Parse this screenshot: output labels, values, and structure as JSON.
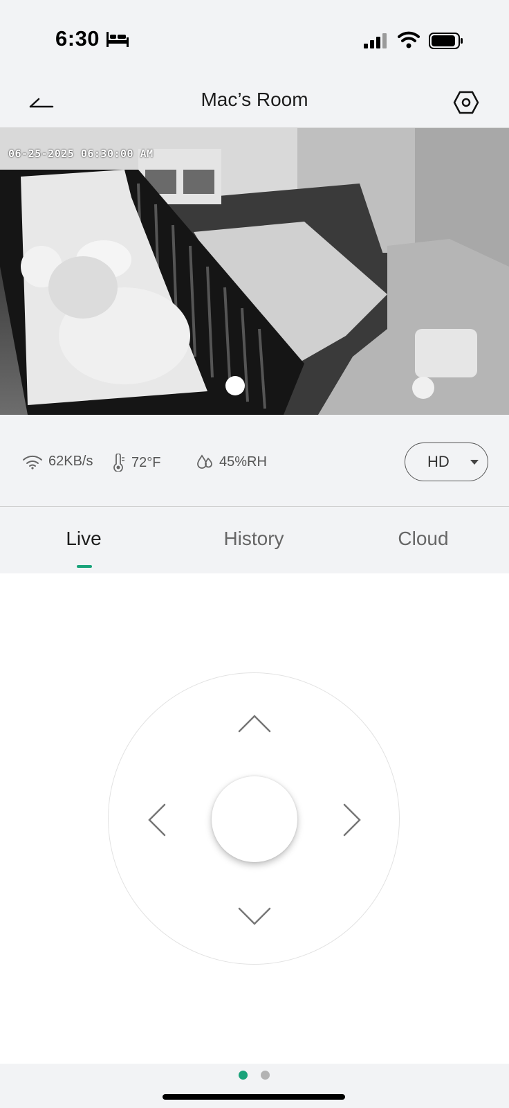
{
  "status_bar": {
    "time": "6:30",
    "icons": [
      "bed-icon",
      "cellular-signal-icon",
      "wifi-icon",
      "battery-icon"
    ]
  },
  "header": {
    "title": "Mac’s Room",
    "back_icon": "back-arrow-icon",
    "settings_icon": "hexagon-settings-icon"
  },
  "camera": {
    "timestamp": "06-25-2025 06:30:00 AM",
    "mode": "night-vision grayscale"
  },
  "stats": {
    "bitrate": "62KB/s",
    "temperature": "72°F",
    "humidity": "45%RH"
  },
  "quality": {
    "selected": "HD"
  },
  "tabs": [
    {
      "label": "Live",
      "active": true
    },
    {
      "label": "History",
      "active": false
    },
    {
      "label": "Cloud",
      "active": false
    }
  ],
  "ptz": {
    "icons": [
      "chevron-up-icon",
      "chevron-down-icon",
      "chevron-left-icon",
      "chevron-right-icon"
    ]
  },
  "pager": {
    "total": 2,
    "current": 1
  },
  "colors": {
    "accent": "#1aa37a",
    "background": "#f2f3f5",
    "text_primary": "#1d1d1d",
    "text_secondary": "#555555",
    "dot_inactive": "#b3b3b3"
  }
}
